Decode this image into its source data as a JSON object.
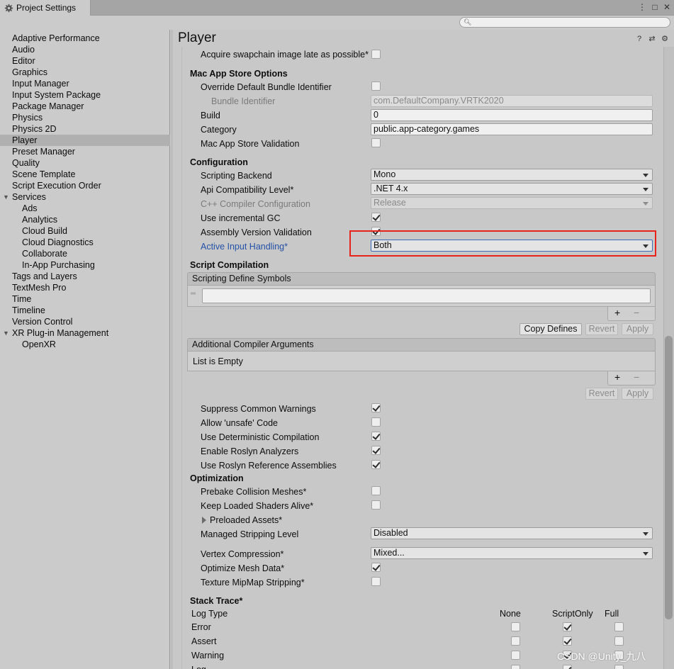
{
  "window": {
    "tab_title": "Project Settings",
    "icons": [
      "menu-icon",
      "maximize-icon",
      "close-icon"
    ]
  },
  "search": {
    "placeholder": "",
    "value": ""
  },
  "sidebar": {
    "items": [
      {
        "label": "Adaptive Performance",
        "level": 0
      },
      {
        "label": "Audio",
        "level": 0
      },
      {
        "label": "Editor",
        "level": 0
      },
      {
        "label": "Graphics",
        "level": 0
      },
      {
        "label": "Input Manager",
        "level": 0
      },
      {
        "label": "Input System Package",
        "level": 0
      },
      {
        "label": "Package Manager",
        "level": 0
      },
      {
        "label": "Physics",
        "level": 0
      },
      {
        "label": "Physics 2D",
        "level": 0
      },
      {
        "label": "Player",
        "level": 0,
        "selected": true
      },
      {
        "label": "Preset Manager",
        "level": 0
      },
      {
        "label": "Quality",
        "level": 0
      },
      {
        "label": "Scene Template",
        "level": 0
      },
      {
        "label": "Script Execution Order",
        "level": 0
      },
      {
        "label": "Services",
        "level": 0,
        "foldout": "open"
      },
      {
        "label": "Ads",
        "level": 1
      },
      {
        "label": "Analytics",
        "level": 1
      },
      {
        "label": "Cloud Build",
        "level": 1
      },
      {
        "label": "Cloud Diagnostics",
        "level": 1
      },
      {
        "label": "Collaborate",
        "level": 1
      },
      {
        "label": "In-App Purchasing",
        "level": 1
      },
      {
        "label": "Tags and Layers",
        "level": 0
      },
      {
        "label": "TextMesh Pro",
        "level": 0
      },
      {
        "label": "Time",
        "level": 0
      },
      {
        "label": "Timeline",
        "level": 0
      },
      {
        "label": "Version Control",
        "level": 0
      },
      {
        "label": "XR Plug-in Management",
        "level": 0,
        "foldout": "open"
      },
      {
        "label": "OpenXR",
        "level": 1
      }
    ]
  },
  "page": {
    "title": "Player",
    "header_icons": [
      "help-icon",
      "preset-icon",
      "settings-icon"
    ]
  },
  "settings": {
    "acquire_swapchain": {
      "label": "Acquire swapchain image late as possible*",
      "checked": false
    },
    "mac_app_store": {
      "header": "Mac App Store Options",
      "override_bundle": {
        "label": "Override Default Bundle Identifier",
        "checked": false
      },
      "bundle_identifier": {
        "label": "Bundle Identifier",
        "value": "com.DefaultCompany.VRTK2020"
      },
      "build": {
        "label": "Build",
        "value": "0"
      },
      "category": {
        "label": "Category",
        "value": "public.app-category.games"
      },
      "validation": {
        "label": "Mac App Store Validation",
        "checked": false
      }
    },
    "configuration": {
      "header": "Configuration",
      "scripting_backend": {
        "label": "Scripting Backend",
        "value": "Mono"
      },
      "api_compat": {
        "label": "Api Compatibility Level*",
        "value": ".NET 4.x"
      },
      "cpp_compiler": {
        "label": "C++ Compiler Configuration",
        "value": "Release"
      },
      "incremental_gc": {
        "label": "Use incremental GC",
        "checked": true
      },
      "assembly_validation": {
        "label": "Assembly Version Validation",
        "checked": true
      },
      "active_input": {
        "label": "Active Input Handling*",
        "value": "Both"
      }
    },
    "script_compilation": {
      "header": "Script Compilation",
      "define_symbols": {
        "label": "Scripting Define Symbols",
        "value": ""
      },
      "add": "+",
      "remove": "−",
      "copy_defines": "Copy Defines",
      "revert": "Revert",
      "apply": "Apply",
      "compiler_args": {
        "label": "Additional Compiler Arguments",
        "empty_text": "List is Empty"
      },
      "revert2": "Revert",
      "apply2": "Apply",
      "suppress_warnings": {
        "label": "Suppress Common Warnings",
        "checked": true
      },
      "allow_unsafe": {
        "label": "Allow 'unsafe' Code",
        "checked": false
      },
      "deterministic": {
        "label": "Use Deterministic Compilation",
        "checked": true
      },
      "roslyn_analyzers": {
        "label": "Enable Roslyn Analyzers",
        "checked": true
      },
      "roslyn_reference": {
        "label": "Use Roslyn Reference Assemblies",
        "checked": true
      }
    },
    "optimization": {
      "header": "Optimization",
      "prebake": {
        "label": "Prebake Collision Meshes*",
        "checked": false
      },
      "keep_shaders": {
        "label": "Keep Loaded Shaders Alive*",
        "checked": false
      },
      "preloaded_assets": {
        "label": "Preloaded Assets*"
      },
      "stripping_level": {
        "label": "Managed Stripping Level",
        "value": "Disabled"
      },
      "vertex_compression": {
        "label": "Vertex Compression*",
        "value": "Mixed..."
      },
      "optimize_mesh": {
        "label": "Optimize Mesh Data*",
        "checked": true
      },
      "texture_mipmap": {
        "label": "Texture MipMap Stripping*",
        "checked": false
      }
    },
    "stack_trace": {
      "header": "Stack Trace*",
      "columns": [
        "Log Type",
        "None",
        "ScriptOnly",
        "Full"
      ],
      "rows": [
        {
          "type": "Error",
          "none": false,
          "script_only": true,
          "full": false
        },
        {
          "type": "Assert",
          "none": false,
          "script_only": true,
          "full": false
        },
        {
          "type": "Warning",
          "none": false,
          "script_only": true,
          "full": false
        },
        {
          "type": "Log",
          "none": false,
          "script_only": true,
          "full": false
        }
      ]
    }
  },
  "watermark": "CSDN @Unity_九八",
  "colors": {
    "highlight_box": "#e8231c",
    "link_label": "#2452a8",
    "selected_item": "#b0b0b0"
  }
}
